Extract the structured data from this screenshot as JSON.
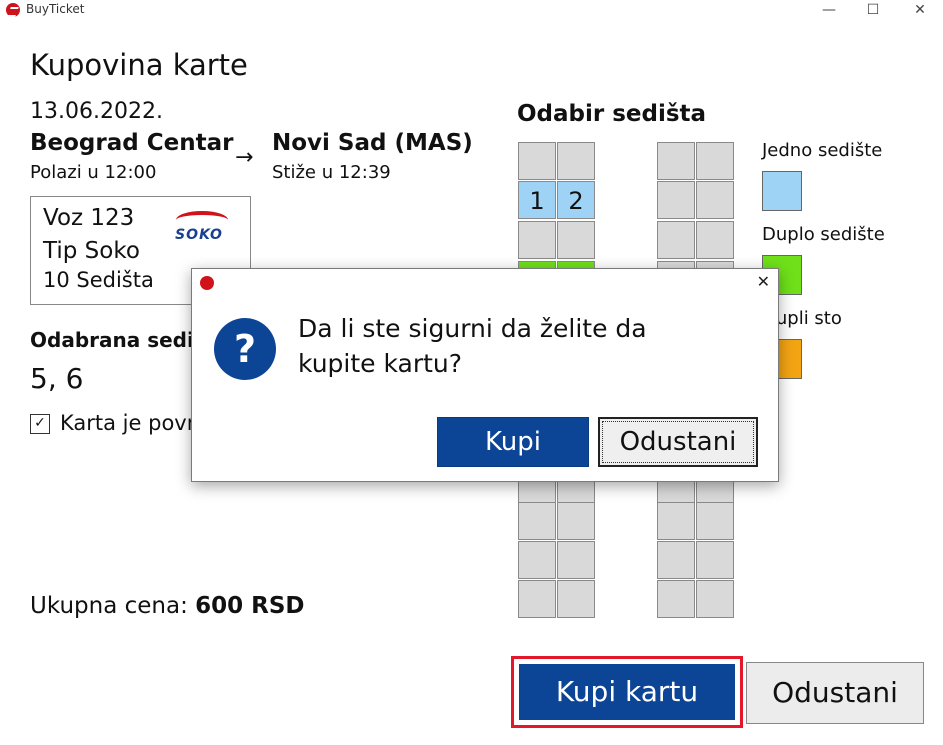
{
  "window": {
    "title": "BuyTicket",
    "minimize": "—",
    "maximize": "☐",
    "close": "✕"
  },
  "page": {
    "title": "Kupovina karte"
  },
  "trip": {
    "date": "13.06.2022.",
    "from": {
      "name": "Beograd Centar",
      "time": "Polazi u 12:00"
    },
    "arrow": "→",
    "to": {
      "name": "Novi Sad (MAS)",
      "time": "Stiže u 12:39"
    }
  },
  "train": {
    "line1": "Voz 123",
    "line2": "Tip Soko",
    "line3": "10 Sedišta",
    "logo": "SOKO"
  },
  "selection": {
    "label": "Odabrana sedišta",
    "value": "5, 6",
    "checkbox_label": "Karta je povratna",
    "checked_glyph": "✓"
  },
  "price": {
    "label": "Ukupna cena:",
    "value": "600 RSD"
  },
  "seats": {
    "title": "Odabir sedišta",
    "seat1": "1",
    "seat2": "2"
  },
  "legend": {
    "single": "Jedno sedište",
    "double": "Duplo sedište",
    "table": "Dupli sto"
  },
  "colors": {
    "single": "#9fd3f5",
    "double": "#6fe01a",
    "table": "#f3a413",
    "primary": "#0c4596"
  },
  "buttons": {
    "buy": "Kupi kartu",
    "cancel": "Odustani"
  },
  "dialog": {
    "close": "✕",
    "icon": "?",
    "message": "Da li ste sigurni da želite da kupite kartu?",
    "ok": "Kupi",
    "cancel": "Odustani"
  }
}
